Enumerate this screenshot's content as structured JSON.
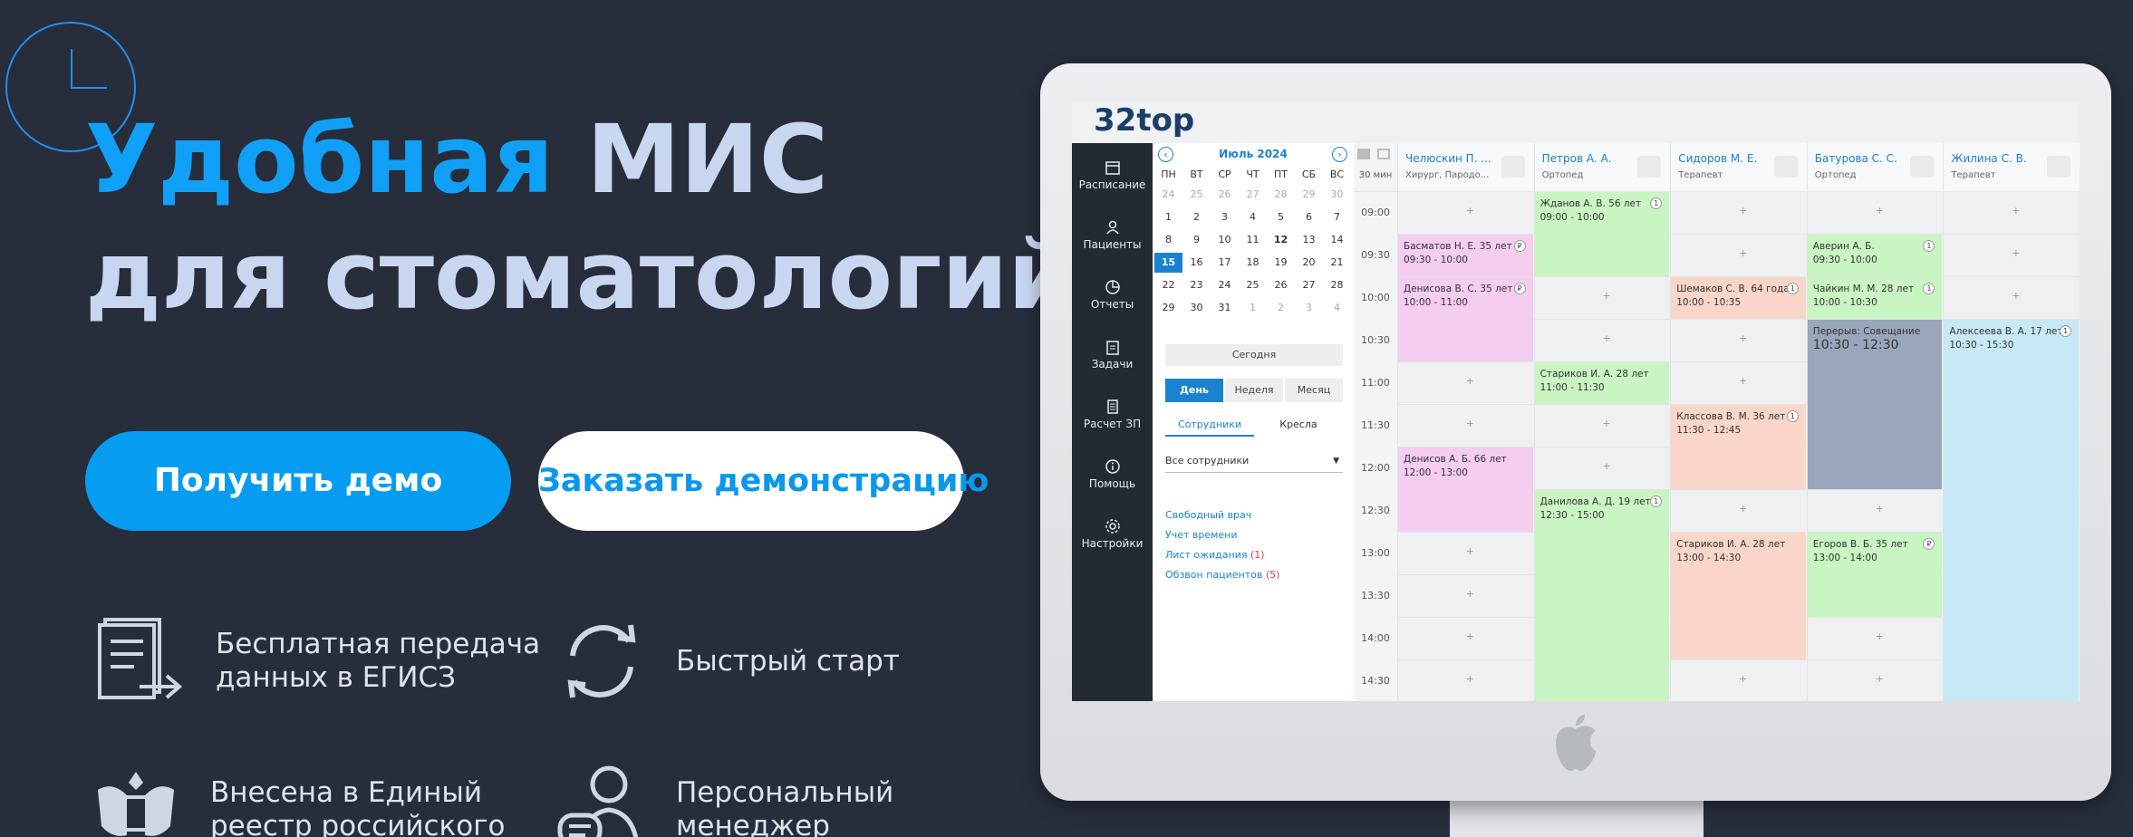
{
  "hero": {
    "title_accent": "Удобная",
    "title_rest": " МИС",
    "title_line2": "для стоматологий",
    "btn_demo": "Получить демо",
    "btn_order": "Заказать демонстрацию"
  },
  "features": [
    {
      "icon": "document-transfer-icon",
      "line1": "Бесплатная передача",
      "line2": "данных в ЕГИСЗ"
    },
    {
      "icon": "refresh-icon",
      "line1": "Быстрый старт",
      "line2": ""
    },
    {
      "icon": "russian-emblem-icon",
      "line1": "Внесена в Единый",
      "line2": "реестр российского"
    },
    {
      "icon": "manager-chat-icon",
      "line1": "Персональный",
      "line2": "менеджер"
    }
  ],
  "app": {
    "logo": "32top",
    "sidebar": [
      {
        "label": "Расписание",
        "icon": "calendar-icon"
      },
      {
        "label": "Пациенты",
        "icon": "user-icon"
      },
      {
        "label": "Отчеты",
        "icon": "pie-chart-icon"
      },
      {
        "label": "Задачи",
        "icon": "clipboard-icon"
      },
      {
        "label": "Расчет ЗП",
        "icon": "calculator-icon"
      },
      {
        "label": "Помощь",
        "icon": "info-icon"
      },
      {
        "label": "Настройки",
        "icon": "gear-icon"
      }
    ],
    "calendar": {
      "month": "Июль 2024",
      "dow": [
        "ПН",
        "ВТ",
        "СР",
        "ЧТ",
        "ПТ",
        "СБ",
        "ВС"
      ],
      "weeks": [
        [
          "24",
          "25",
          "26",
          "27",
          "28",
          "29",
          "30"
        ],
        [
          "1",
          "2",
          "3",
          "4",
          "5",
          "6",
          "7"
        ],
        [
          "8",
          "9",
          "10",
          "11",
          "12",
          "13",
          "14"
        ],
        [
          "15",
          "16",
          "17",
          "18",
          "19",
          "20",
          "21"
        ],
        [
          "22",
          "23",
          "24",
          "25",
          "26",
          "27",
          "28"
        ],
        [
          "29",
          "30",
          "31",
          "1",
          "2",
          "3",
          "4"
        ]
      ],
      "today": "Сегодня",
      "views": [
        "День",
        "Неделя",
        "Месяц"
      ],
      "tabs": [
        "Сотрудники",
        "Кресла"
      ],
      "employee_select": "Все сотрудники",
      "links": [
        {
          "label": "Свободный врач",
          "count": ""
        },
        {
          "label": "Учет времени",
          "count": ""
        },
        {
          "label": "Лист ожидания",
          "count": "(1)"
        },
        {
          "label": "Обзвон пациентов",
          "count": "(5)"
        }
      ]
    },
    "interval": "30 мин",
    "times": [
      "09:00",
      "09:30",
      "10:00",
      "10:30",
      "11:00",
      "11:30",
      "12:00",
      "12:30",
      "13:00",
      "13:30",
      "14:00",
      "14:30"
    ],
    "doctors": [
      {
        "name": "Челюскин П. ...",
        "spec": "Хирург, Пародо..."
      },
      {
        "name": "Петров А. А.",
        "spec": "Ортопед"
      },
      {
        "name": "Сидоров М. Е.",
        "spec": "Терапевт"
      },
      {
        "name": "Батурова С. С.",
        "spec": "Ортопед"
      },
      {
        "name": "Жилина С. В.",
        "spec": "Терапевт"
      }
    ],
    "appointments": [
      {
        "col": 0,
        "start": 1,
        "len": 1,
        "color": "pink",
        "name": "Басматов Н. Е. 35 лет",
        "time": "09:30 - 10:00",
        "badge": "₽"
      },
      {
        "col": 0,
        "start": 2,
        "len": 2,
        "color": "pink",
        "name": "Денисова В. С. 35 лет",
        "time": "10:00 - 11:00",
        "badge": "₽"
      },
      {
        "col": 0,
        "start": 6,
        "len": 2,
        "color": "pink",
        "name": "Денисов А. Б. 66 лет",
        "time": "12:00 - 13:00",
        "badge": ""
      },
      {
        "col": 1,
        "start": 0,
        "len": 2,
        "color": "green",
        "name": "Жданов А. В. 56 лет",
        "time": "09:00 - 10:00",
        "badge": "1"
      },
      {
        "col": 1,
        "start": 4,
        "len": 1,
        "color": "green",
        "name": "Стариков И. А. 28 лет",
        "time": "11:00 - 11:30",
        "badge": ""
      },
      {
        "col": 1,
        "start": 7,
        "len": 5,
        "color": "green",
        "name": "Данилова А. Д. 19 лет",
        "time": "12:30 - 15:00",
        "badge": "1"
      },
      {
        "col": 2,
        "start": 2,
        "len": 1,
        "color": "peach",
        "name": "Шемаков С. В. 64 года",
        "time": "10:00 - 10:35",
        "badge": "1"
      },
      {
        "col": 2,
        "start": 5,
        "len": 2,
        "color": "peach",
        "name": "Классова В. М. 36 лет",
        "time": "11:30 - 12:45",
        "badge": "1"
      },
      {
        "col": 2,
        "start": 8,
        "len": 3,
        "color": "peach",
        "name": "Стариков И. А. 28 лет",
        "time": "13:00 - 14:30",
        "badge": ""
      },
      {
        "col": 3,
        "start": 1,
        "len": 1,
        "color": "green",
        "name": "Аверин А. Б.",
        "time": "09:30 - 10:00",
        "badge": "1"
      },
      {
        "col": 3,
        "start": 2,
        "len": 1,
        "color": "green",
        "name": "Чайкин М. М. 28 лет",
        "time": "10:00 - 10:30",
        "badge": "1"
      },
      {
        "col": 3,
        "start": 3,
        "len": 4,
        "color": "grey",
        "name": "Перерыв: Совещание",
        "time": "10:30 - 12:30",
        "badge": ""
      },
      {
        "col": 3,
        "start": 8,
        "len": 2,
        "color": "green",
        "name": "Егоров В. Б. 35 лет",
        "time": "13:00 - 14:00",
        "badge": "₽"
      },
      {
        "col": 4,
        "start": 3,
        "len": 9,
        "color": "blue",
        "name": "Алексеева В. А. 17 лет",
        "time": "10:30 - 15:30",
        "badge": "1"
      }
    ]
  }
}
